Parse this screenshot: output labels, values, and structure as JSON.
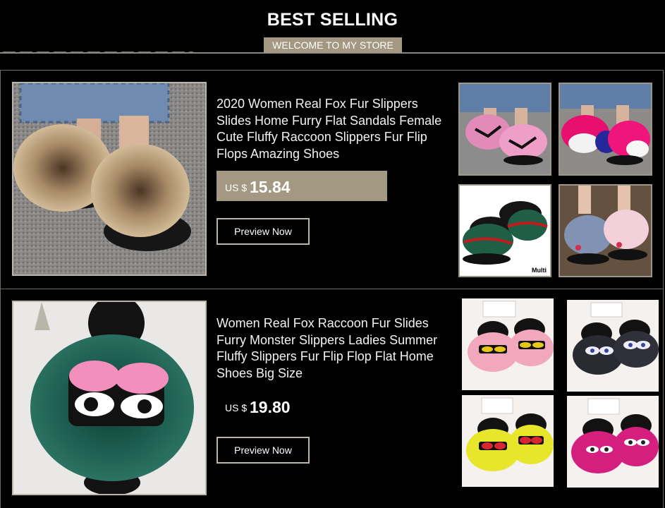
{
  "header": {
    "title": "BEST SELLING",
    "welcome": "WELCOME TO MY STORE"
  },
  "products": [
    {
      "name": "2020 Women Real Fox Fur Slippers Slides Home Furry Flat Sandals Female Cute Fluffy Raccoon Slippers Fur Flip Flops Amazing Shoes",
      "currency": "US $",
      "price": "15.84",
      "button": "Preview Now",
      "thumbnails": [
        {
          "label": ""
        },
        {
          "label": ""
        },
        {
          "label": "Multi"
        },
        {
          "label": ""
        }
      ]
    },
    {
      "name": "Women Real Fox Raccoon Fur Slides Furry Monster Slippers Ladies Summer Fluffy Slippers Fur Flip Flop Flat Home Shoes Big Size",
      "currency": "US $",
      "price": "19.80",
      "button": "Preview Now",
      "thumbnails": [
        {
          "label": ""
        },
        {
          "label": ""
        },
        {
          "label": ""
        },
        {
          "label": ""
        }
      ]
    }
  ],
  "colors": {
    "accent": "#a39982",
    "border": "#bdb6a8",
    "background": "#000000"
  }
}
